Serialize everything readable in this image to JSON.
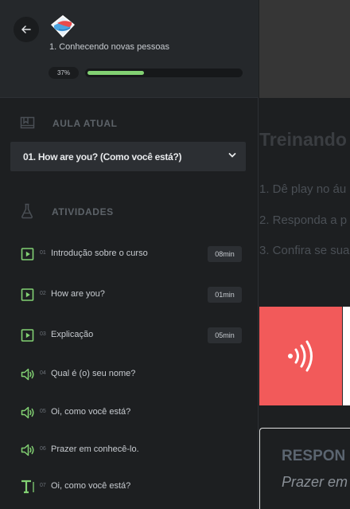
{
  "header": {
    "course_title": "1. Conhecendo novas pessoas",
    "progress_label": "37%",
    "progress_fraction": 0.37
  },
  "sections": {
    "current": "AULA ATUAL",
    "activities": "ATIVIDADES"
  },
  "current_lesson": "01. How are you? (Como você está?)",
  "activities": [
    {
      "num": "01",
      "label": "Introdução sobre o curso",
      "duration": "08min",
      "icon": "play-icon"
    },
    {
      "num": "02",
      "label": "How are you?",
      "duration": "01min",
      "icon": "play-icon"
    },
    {
      "num": "03",
      "label": "Explicação",
      "duration": "05min",
      "icon": "play-icon"
    },
    {
      "num": "04",
      "label": "Qual é (o) seu nome?",
      "duration": "",
      "icon": "speaker-icon"
    },
    {
      "num": "05",
      "label": "Oi, como você está?",
      "duration": "",
      "icon": "speaker-icon"
    },
    {
      "num": "06",
      "label": "Prazer em conhecê-lo.",
      "duration": "",
      "icon": "speaker-icon"
    },
    {
      "num": "07",
      "label": "Oi, como você está?",
      "duration": "",
      "icon": "text-icon"
    }
  ],
  "main": {
    "heading": "Treinando",
    "steps": [
      "1. Dê play no áu",
      "2. Responda a p",
      "3. Confira se sua"
    ],
    "response_title": "RESPON",
    "response_sub": "Prazer em"
  },
  "colors": {
    "accent": "#82d173",
    "audio_card": "#f25a5a"
  }
}
